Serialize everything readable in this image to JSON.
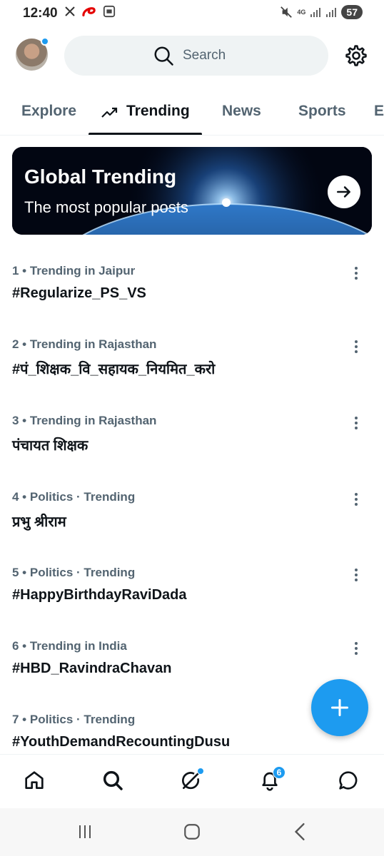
{
  "status_bar": {
    "time": "12:40",
    "network": "4G",
    "battery": "57",
    "icons": [
      "x-logo-icon",
      "airtel-icon",
      "screenshot-icon",
      "mute-icon",
      "signal-icon",
      "signal-icon-2"
    ]
  },
  "header": {
    "avatar_icon": "profile-avatar",
    "search_placeholder": "Search",
    "settings_icon": "gear-icon"
  },
  "tabs": [
    {
      "label": "Explore",
      "active": false
    },
    {
      "label": "Trending",
      "active": true,
      "icon": "trending-arrow-icon"
    },
    {
      "label": "News",
      "active": false
    },
    {
      "label": "Sports",
      "active": false
    },
    {
      "label": "E",
      "active": false
    }
  ],
  "banner": {
    "title": "Global Trending",
    "subtitle": "The most popular posts",
    "button_icon": "arrow-right-icon"
  },
  "trends": [
    {
      "meta": "1 • Trending in Jaipur",
      "title": "#Regularize_PS_VS"
    },
    {
      "meta": "2 • Trending in Rajasthan",
      "title": "#पं_शिक्षक_वि_सहायक_नियमित_करो"
    },
    {
      "meta": "3 • Trending in Rajasthan",
      "title": "पंचायत शिक्षक"
    },
    {
      "meta": "4 • Politics · Trending",
      "title": "प्रभु श्रीराम"
    },
    {
      "meta": "5 • Politics · Trending",
      "title": "#HappyBirthdayRaviDada"
    },
    {
      "meta": "6 • Trending in India",
      "title": "#HBD_RavindraChavan"
    },
    {
      "meta": "7 • Politics · Trending",
      "title": "#YouthDemandRecountingDusu"
    }
  ],
  "fab": {
    "icon": "plus-icon"
  },
  "bottom_nav": {
    "items": [
      "home-icon",
      "search-icon",
      "grok-icon",
      "notifications-icon",
      "messages-icon"
    ],
    "notifications_badge": "6"
  },
  "system_nav": [
    "recent-apps-icon",
    "home-button-icon",
    "back-icon"
  ],
  "colors": {
    "accent": "#1d9bf0",
    "text_primary": "#0f1419",
    "text_secondary": "#536471",
    "search_bg": "#eff3f4"
  }
}
